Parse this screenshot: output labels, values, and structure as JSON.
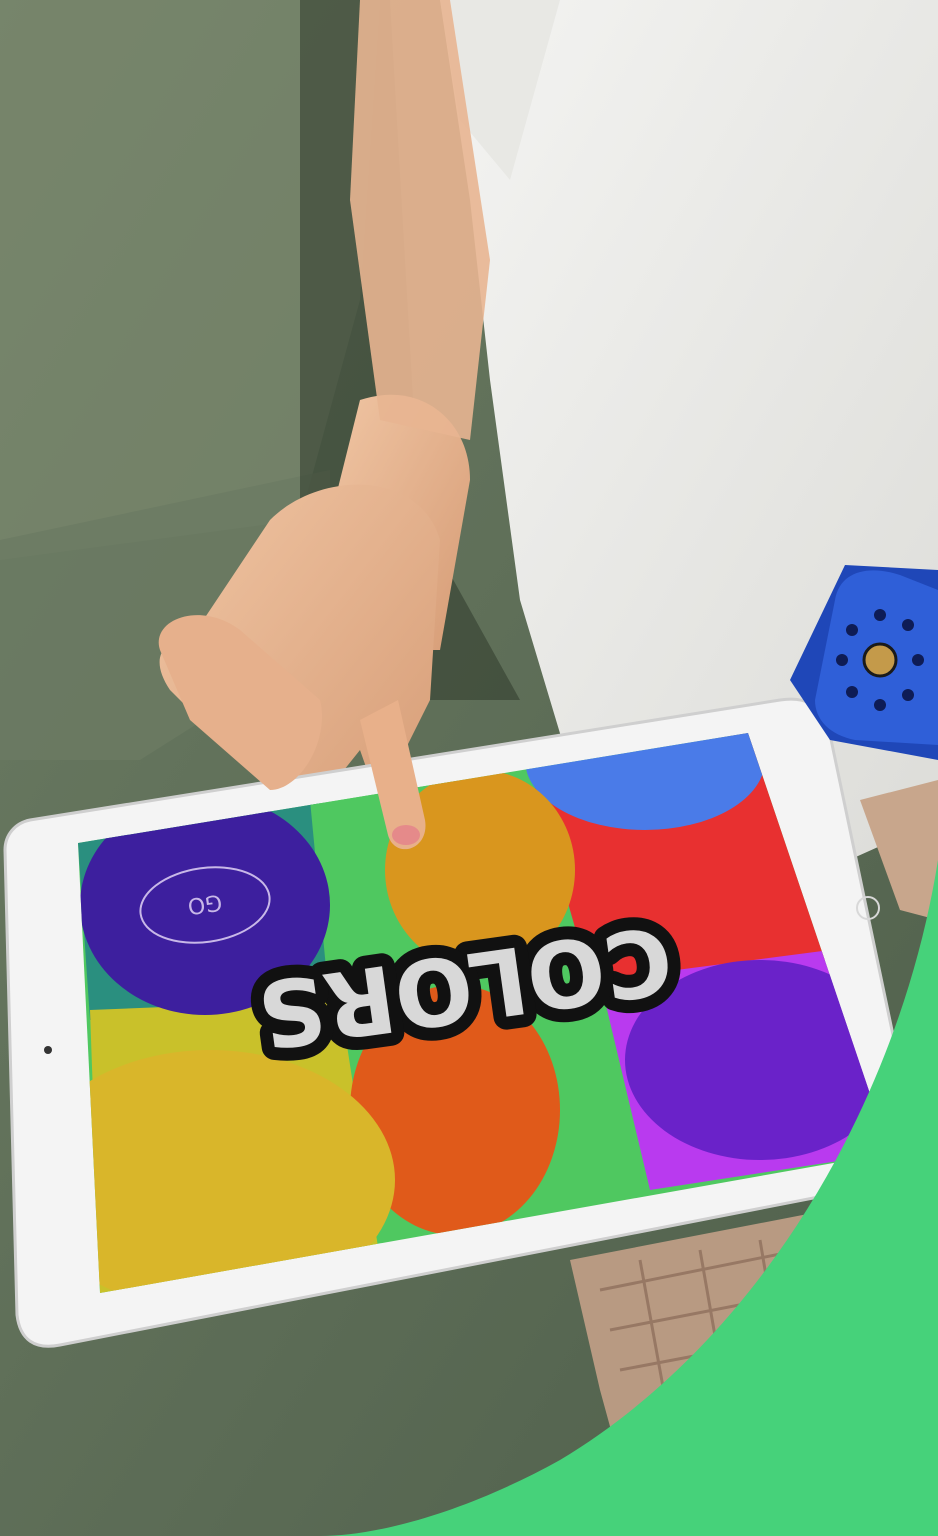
{
  "tablet_app": {
    "title": "COLORS",
    "go_button_label": "GO"
  },
  "colors": {
    "accent_green": "#46d27a",
    "tile_blue": "#4a7be8",
    "tile_red": "#e83030",
    "tile_purple": "#b93aef",
    "tile_orange": "#e27b1e",
    "tile_yellow": "#d9b62a",
    "tile_green": "#4fc860",
    "tile_teal": "#2a8f7f",
    "circle_indigo": "#3d1f9e",
    "cube_blue": "#2f5fd8"
  }
}
